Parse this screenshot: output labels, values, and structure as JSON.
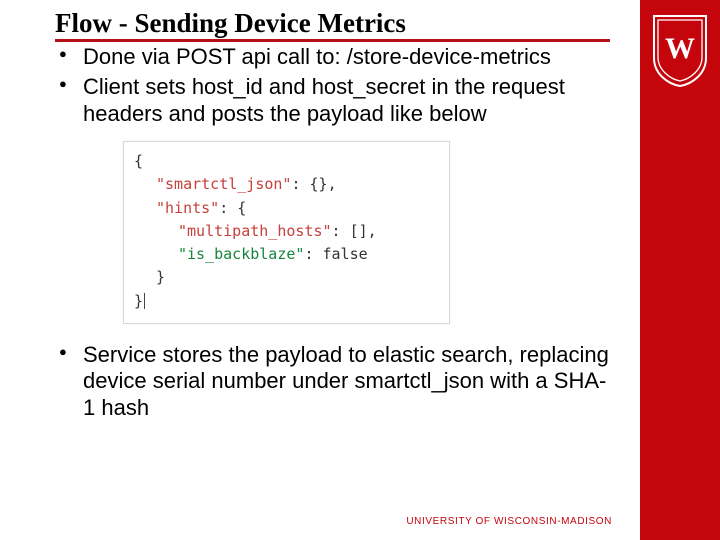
{
  "title": "Flow - Sending Device Metrics",
  "bullets": {
    "b1": "Done via POST api call to: /store-device-metrics",
    "b2": "Client sets host_id and host_secret in the request headers and posts the payload like below",
    "b3": "Service stores the payload to elastic search, replacing device serial number under smartctl_json with a SHA-1 hash"
  },
  "code": {
    "open_brace": "{",
    "line1_key": "\"smartctl_json\"",
    "line1_rest": ": {},",
    "line2_key": "\"hints\"",
    "line2_rest": ": {",
    "line3_key": "\"multipath_hosts\"",
    "line3_rest": ": [],",
    "line4_key": "\"is_backblaze\"",
    "line4_rest": ": false",
    "line5": "}",
    "close_brace": "}"
  },
  "footer": "UNIVERSITY OF WISCONSIN-MADISON"
}
